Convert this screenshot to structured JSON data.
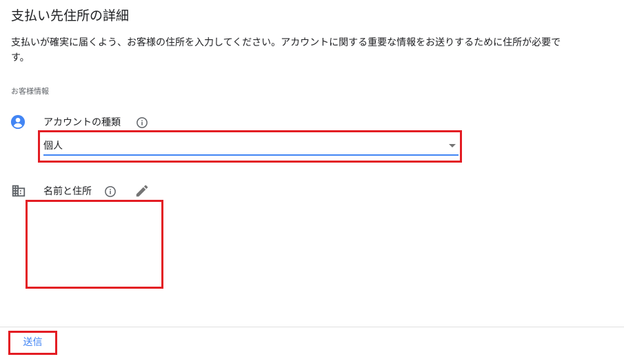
{
  "page": {
    "title": "支払い先住所の詳細",
    "description_line1": "支払いが確実に届くよう、お客様の住所を入力してください。アカウントに関する重要な情報をお送りするために住所が必要で",
    "description_line2": "す。"
  },
  "customer_info": {
    "section_label": "お客様情報",
    "account_type": {
      "label": "アカウントの種類",
      "selected_value": "個人"
    },
    "name_address": {
      "label": "名前と住所"
    }
  },
  "actions": {
    "submit_label": "送信"
  },
  "colors": {
    "accent": "#4285f4",
    "highlight": "#e31c23",
    "icon": "#4285f4",
    "muted_icon": "#5f6368"
  }
}
